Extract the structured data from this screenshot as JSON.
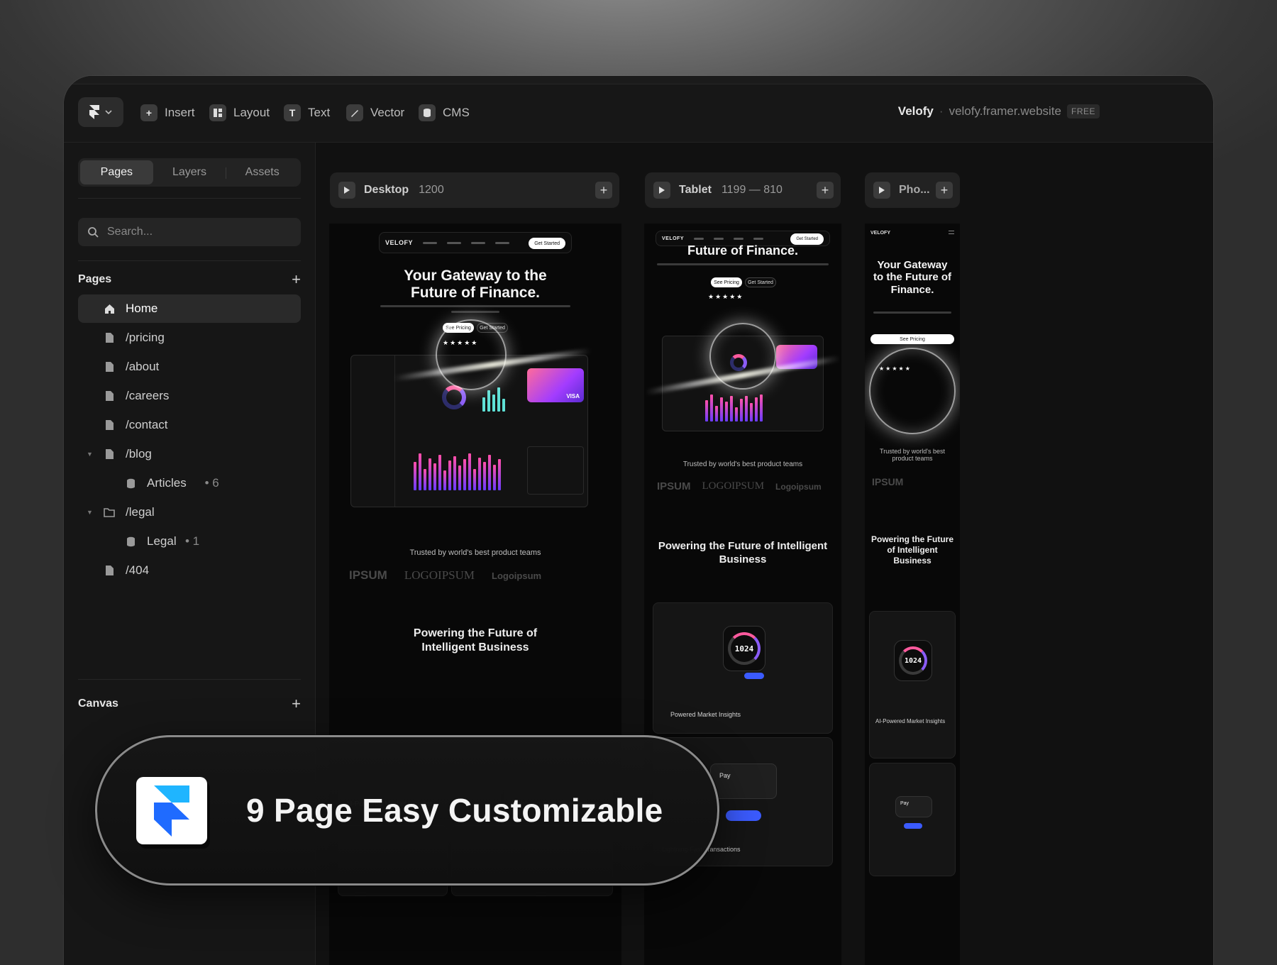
{
  "topbar": {
    "tools": [
      {
        "label": "Insert",
        "icon": "plus-square-icon"
      },
      {
        "label": "Layout",
        "icon": "layout-icon"
      },
      {
        "label": "Text",
        "icon": "text-icon"
      },
      {
        "label": "Vector",
        "icon": "pen-icon"
      },
      {
        "label": "CMS",
        "icon": "database-icon"
      }
    ],
    "project_name": "Velofy",
    "separator": "·",
    "project_url": "velofy.framer.website",
    "plan_badge": "FREE"
  },
  "sidebar": {
    "tabs": [
      "Pages",
      "Layers",
      "Assets"
    ],
    "active_tab": "Pages",
    "search_placeholder": "Search...",
    "pages_heading": "Pages",
    "pages": [
      {
        "label": "Home",
        "icon": "home-icon",
        "selected": true
      },
      {
        "label": "/pricing",
        "icon": "page-icon"
      },
      {
        "label": "/about",
        "icon": "page-icon"
      },
      {
        "label": "/careers",
        "icon": "page-icon"
      },
      {
        "label": "/contact",
        "icon": "page-icon"
      },
      {
        "label": "/blog",
        "icon": "page-icon",
        "expanded": true
      },
      {
        "label": "Articles",
        "count": "• 6",
        "icon": "database-icon",
        "child": true
      },
      {
        "label": "/legal",
        "icon": "folder-icon",
        "expanded": true
      },
      {
        "label": "Legal",
        "count": "• 1",
        "icon": "database-icon",
        "child": true
      },
      {
        "label": "/404",
        "icon": "page-icon"
      }
    ],
    "canvas_heading": "Canvas"
  },
  "breakpoints": [
    {
      "name": "Desktop",
      "size": "1200"
    },
    {
      "name": "Tablet",
      "size": "1199 — 810"
    },
    {
      "name": "Pho...",
      "size": ""
    }
  ],
  "site": {
    "brand": "VELOFY",
    "cta": "Get Started",
    "hero_line1": "Your Gateway to the",
    "hero_line2": "Future of Finance.",
    "hero_phone": "Your Gateway to the Future of Finance.",
    "btn_primary": "See Pricing",
    "btn_secondary": "Get Started",
    "stars": "★★★★★",
    "trusted": "Trusted by world's best product teams",
    "logos": [
      "IPSUM",
      "LOGOIPSUM",
      "Logoipsum"
    ],
    "section_title": "Powering the Future of Intelligent Business",
    "feature1": "AI-Powered Market Insights",
    "feature2": "Lightning-Fast Transactions",
    "powered_short": "Powered Market Insights",
    "gauge_value": "1024",
    "pay_label": "Pay",
    "card_brand": "VISA"
  },
  "overlay": {
    "text": "9 Page Easy Customizable",
    "logo_icon": "framer-logo-icon"
  },
  "colors": {
    "accent_pink": "#ff5a9e",
    "accent_purple": "#8b5cf6",
    "accent_blue": "#3b5bff"
  }
}
